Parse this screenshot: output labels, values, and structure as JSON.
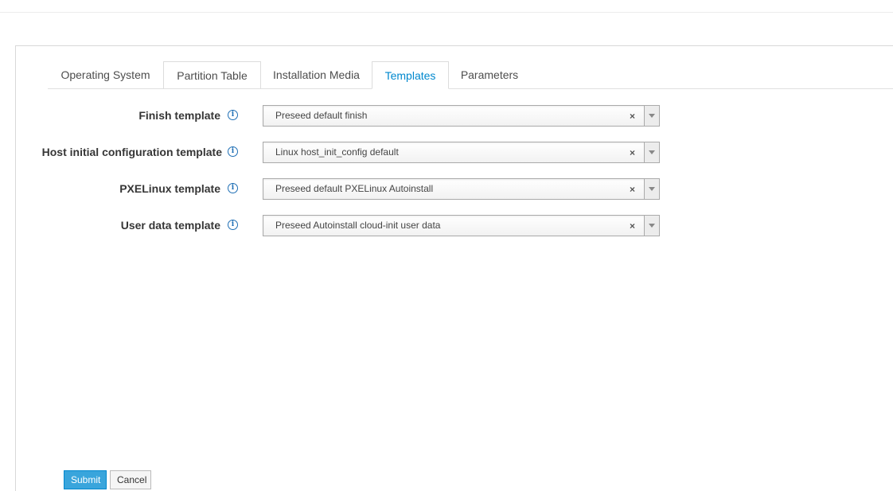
{
  "tabs": [
    {
      "label": "Operating System"
    },
    {
      "label": "Partition Table"
    },
    {
      "label": "Installation Media"
    },
    {
      "label": "Templates",
      "active": true
    },
    {
      "label": "Parameters"
    }
  ],
  "form": {
    "rows": [
      {
        "label": "Finish template",
        "value": "Preseed default finish"
      },
      {
        "label": "Host initial configuration template",
        "value": "Linux host_init_config default"
      },
      {
        "label": "PXELinux template",
        "value": "Preseed default PXELinux Autoinstall"
      },
      {
        "label": "User data template",
        "value": "Preseed Autoinstall cloud-init user data"
      }
    ],
    "info_glyph": "i",
    "clear_glyph": "×"
  },
  "buttons": {
    "submit": "Submit",
    "cancel": "Cancel"
  },
  "colors": {
    "accent": "#0088ce",
    "submit_bg": "#39a5dc",
    "info_icon": "#1f6fb5"
  },
  "icons": [
    "info-icon",
    "clear-icon",
    "chevron-down-icon"
  ]
}
